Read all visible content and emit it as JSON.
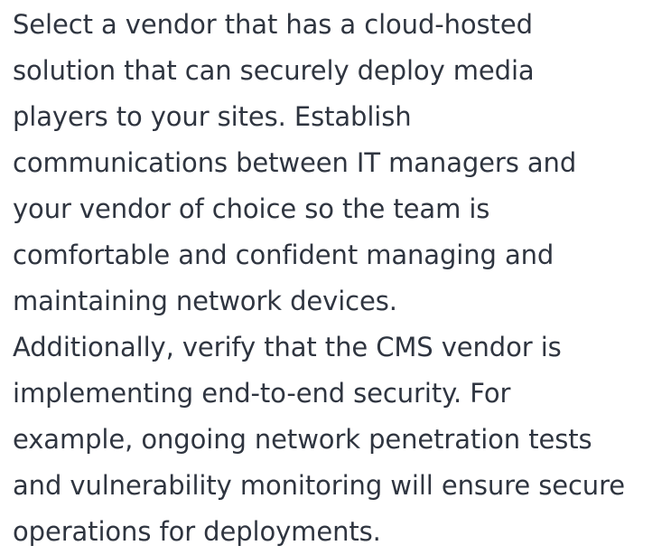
{
  "article": {
    "paragraphs": [
      {
        "lines": [
          "Select a vendor that has a cloud-hosted",
          "solution that can securely deploy media",
          "players to your sites. Establish",
          "communications between IT managers and",
          "your vendor of choice so the team is",
          "comfortable and confident managing and",
          "maintaining network devices."
        ]
      },
      {
        "lines": [
          "Additionally, verify that the CMS vendor is",
          "implementing end-to-end security. For",
          "example, ongoing network penetration tests",
          "and vulnerability monitoring will ensure secure",
          "operations for deployments."
        ]
      }
    ]
  },
  "colors": {
    "text": "#2f3540",
    "background": "#ffffff"
  }
}
